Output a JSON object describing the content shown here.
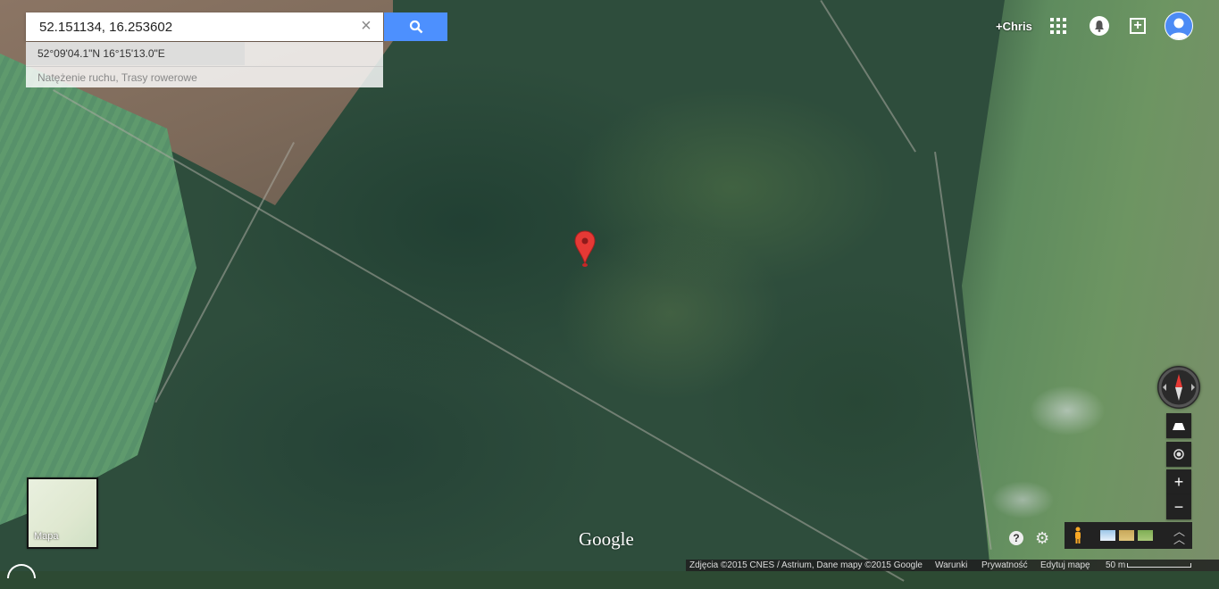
{
  "search": {
    "query": "52.151134, 16.253602",
    "clear_icon": "close-icon",
    "button_icon": "search-icon",
    "suggestion_coords": "52°09'04.1\"N 16°15'13.0\"E",
    "suggestion_layers": "Natężenie ruchu, Trasy rowerowe"
  },
  "account": {
    "user": "+Chris",
    "apps_icon": "apps-grid-icon",
    "notification_icon": "bell-icon",
    "share_icon": "add-icon"
  },
  "minimap": {
    "label": "Mapa"
  },
  "logo": "Google",
  "footer": {
    "attribution": "Zdjęcia ©2015 CNES / Astrium, Dane mapy ©2015 Google",
    "terms": "Warunki",
    "privacy": "Prywatność",
    "edit": "Edytuj mapę",
    "scale": "50 m"
  },
  "controls": {
    "zoom_in": "+",
    "zoom_out": "−",
    "help": "?"
  },
  "colors": {
    "accent": "#4d90fe",
    "marker": "#e53935"
  }
}
